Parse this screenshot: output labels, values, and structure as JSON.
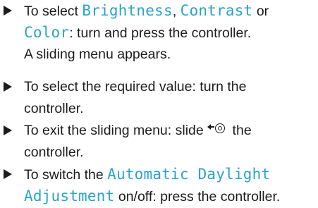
{
  "steps": [
    {
      "l1_pre": "To select ",
      "l1_kw1": "Brightness",
      "l1_mid": ", ",
      "l1_kw2": "Contrast",
      "l1_post": " or",
      "l2_kw": "Color",
      "l2_post": ": turn and press the controller.",
      "l3": "A sliding menu appears."
    },
    {
      "l1": "To select the required value: turn the",
      "l2": "controller."
    },
    {
      "l1_pre": "To exit the sliding menu: slide ",
      "l1_icon": "slide-left-controller-icon",
      "l1_post": " the",
      "l2": "controller."
    },
    {
      "l1_pre": "To switch the ",
      "l1_kw": "Automatic Daylight",
      "l2_kw": "Adjustment",
      "l2_post": " on/off: press the controller."
    }
  ],
  "colors": {
    "text": "#1c1c1c",
    "keyword": "#2aa3c7"
  }
}
